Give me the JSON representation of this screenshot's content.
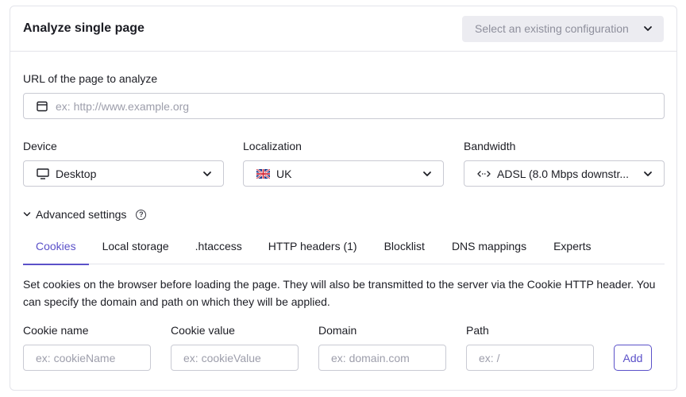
{
  "header": {
    "title": "Analyze single page",
    "config_select_placeholder": "Select an existing configuration"
  },
  "url_section": {
    "label": "URL of the page to analyze",
    "placeholder": "ex: http://www.example.org"
  },
  "device": {
    "label": "Device",
    "value": "Desktop",
    "icon": "monitor-icon"
  },
  "localization": {
    "label": "Localization",
    "value": "UK",
    "icon": "uk-flag-icon"
  },
  "bandwidth": {
    "label": "Bandwidth",
    "value": "ADSL (8.0 Mbps downstr...",
    "icon": "code-arrows-icon"
  },
  "advanced": {
    "label": "Advanced settings"
  },
  "tabs": [
    {
      "label": "Cookies",
      "active": true
    },
    {
      "label": "Local storage"
    },
    {
      "label": ".htaccess"
    },
    {
      "label": "HTTP headers (1)"
    },
    {
      "label": "Blocklist"
    },
    {
      "label": "DNS mappings"
    },
    {
      "label": "Experts"
    }
  ],
  "cookies": {
    "description": "Set cookies on the browser before loading the page. They will also be transmitted to the server via the Cookie HTTP header. You can specify the domain and path on which they will be applied.",
    "fields": [
      {
        "label": "Cookie name",
        "placeholder": "ex: cookieName"
      },
      {
        "label": "Cookie value",
        "placeholder": "ex: cookieValue"
      },
      {
        "label": "Domain",
        "placeholder": "ex: domain.com"
      },
      {
        "label": "Path",
        "placeholder": "ex: /"
      }
    ],
    "add_label": "Add"
  },
  "colors": {
    "accent": "#5b51c9",
    "border": "#c9cad3",
    "placeholder": "#9d9eab"
  }
}
